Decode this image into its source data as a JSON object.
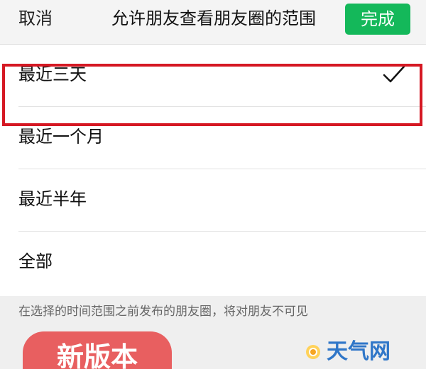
{
  "header": {
    "cancel_label": "取消",
    "title": "允许朋友查看朋友圈的范围",
    "done_label": "完成"
  },
  "options": [
    {
      "label": "最近三天",
      "selected": true
    },
    {
      "label": "最近一个月",
      "selected": false
    },
    {
      "label": "最近半年",
      "selected": false
    },
    {
      "label": "全部",
      "selected": false
    }
  ],
  "footer": {
    "note": "在选择的时间范围之前发布的朋友圈，将对朋友不可见"
  },
  "promo": {
    "label": "新版本"
  },
  "brand": {
    "name": "天气网"
  },
  "colors": {
    "accent_green": "#14b85a",
    "highlight_red": "#d51823",
    "promo_red": "#e85f60",
    "brand_blue": "#2f76c8"
  },
  "icons": {
    "selected_check": "check-icon",
    "brand_logo": "sun-icon"
  }
}
